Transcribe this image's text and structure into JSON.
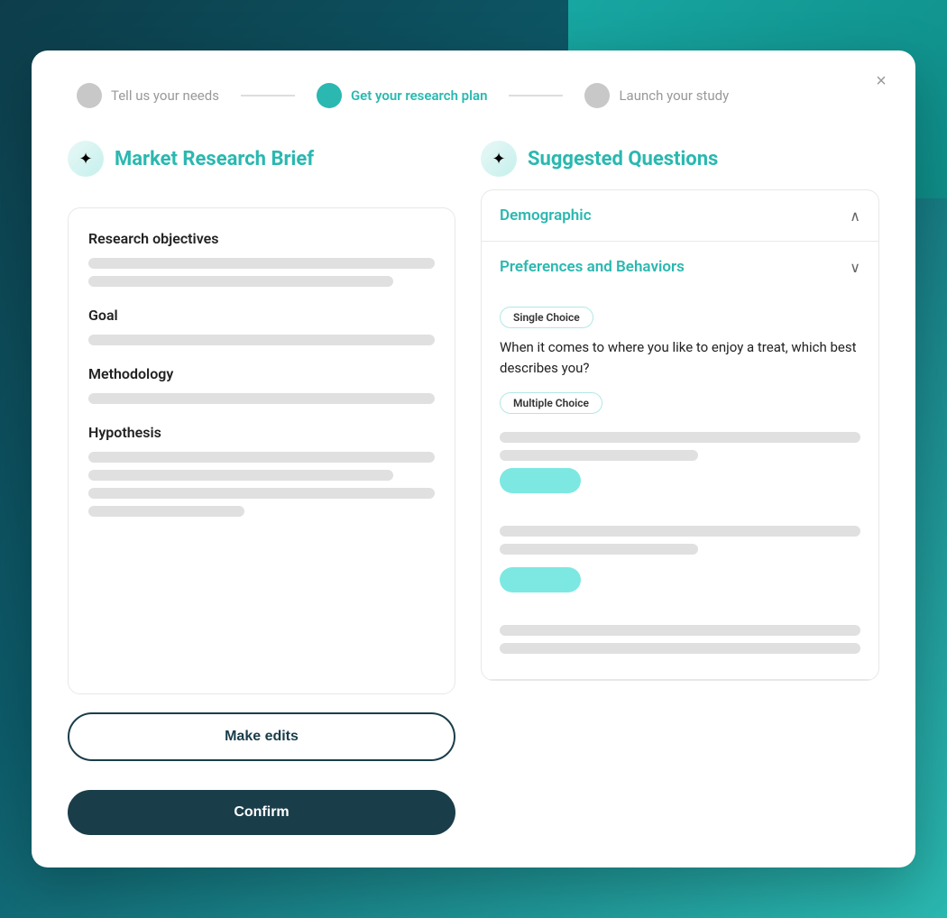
{
  "modal": {
    "close_label": "×"
  },
  "stepper": {
    "steps": [
      {
        "id": "tell",
        "label": "Tell us your needs",
        "active": false
      },
      {
        "id": "get",
        "label": "Get your research plan",
        "active": true
      },
      {
        "id": "launch",
        "label": "Launch your study",
        "active": false
      }
    ]
  },
  "left": {
    "section_title": "Market Research Brief",
    "section_icon": "✦",
    "brief": {
      "research_objectives_label": "Research objectives",
      "goal_label": "Goal",
      "methodology_label": "Methodology",
      "hypothesis_label": "Hypothesis"
    },
    "buttons": {
      "make_edits": "Make edits",
      "confirm": "Confirm"
    }
  },
  "right": {
    "section_title": "Suggested Questions",
    "section_icon": "✦",
    "accordion": [
      {
        "id": "demographic",
        "title": "Demographic",
        "expanded": true,
        "chevron": "∧"
      },
      {
        "id": "preferences",
        "title": "Preferences and Behaviors",
        "expanded": false,
        "chevron": "∨",
        "badge1": "Single Choice",
        "question1": "When it comes to where you like to enjoy a treat, which best describes you?",
        "badge2": "Multiple Choice"
      }
    ]
  }
}
